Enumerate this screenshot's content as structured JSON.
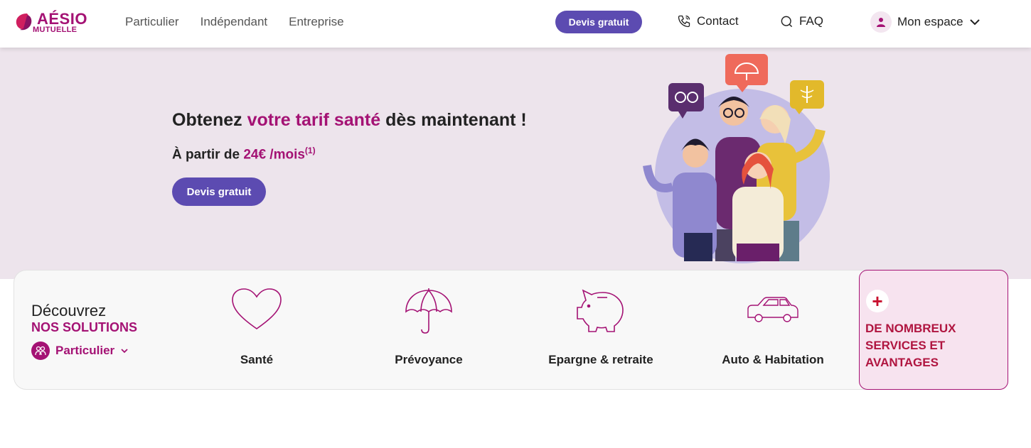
{
  "header": {
    "logo_top": "AÉSIO",
    "logo_bottom": "MUTUELLE",
    "nav": [
      "Particulier",
      "Indépendant",
      "Entreprise"
    ],
    "devis_button": "Devis gratuit",
    "contact_label": "Contact",
    "faq_label": "FAQ",
    "space_label": "Mon espace"
  },
  "hero": {
    "title_prefix": "Obtenez ",
    "title_accent": "votre tarif santé",
    "title_suffix": " dès maintenant !",
    "price_prefix": "À partir de ",
    "price_value": "24€ /mois",
    "price_note": "(1)",
    "button_label": "Devis gratuit"
  },
  "solutions": {
    "title": "Découvrez",
    "subtitle": "NOS SOLUTIONS",
    "selector_label": "Particulier",
    "items": [
      {
        "label": "Santé",
        "icon": "heart-icon"
      },
      {
        "label": "Prévoyance",
        "icon": "umbrella-icon"
      },
      {
        "label": "Epargne & retraite",
        "icon": "piggy-bank-icon"
      },
      {
        "label": "Auto & Habitation",
        "icon": "car-icon"
      }
    ],
    "services_label": "DE NOMBREUX SERVICES ET AVANTAGES"
  },
  "colors": {
    "brand": "#a41274",
    "button": "#5c4bb1",
    "hero_bg": "#ede4ec",
    "services_bg": "#f7e3ef"
  }
}
